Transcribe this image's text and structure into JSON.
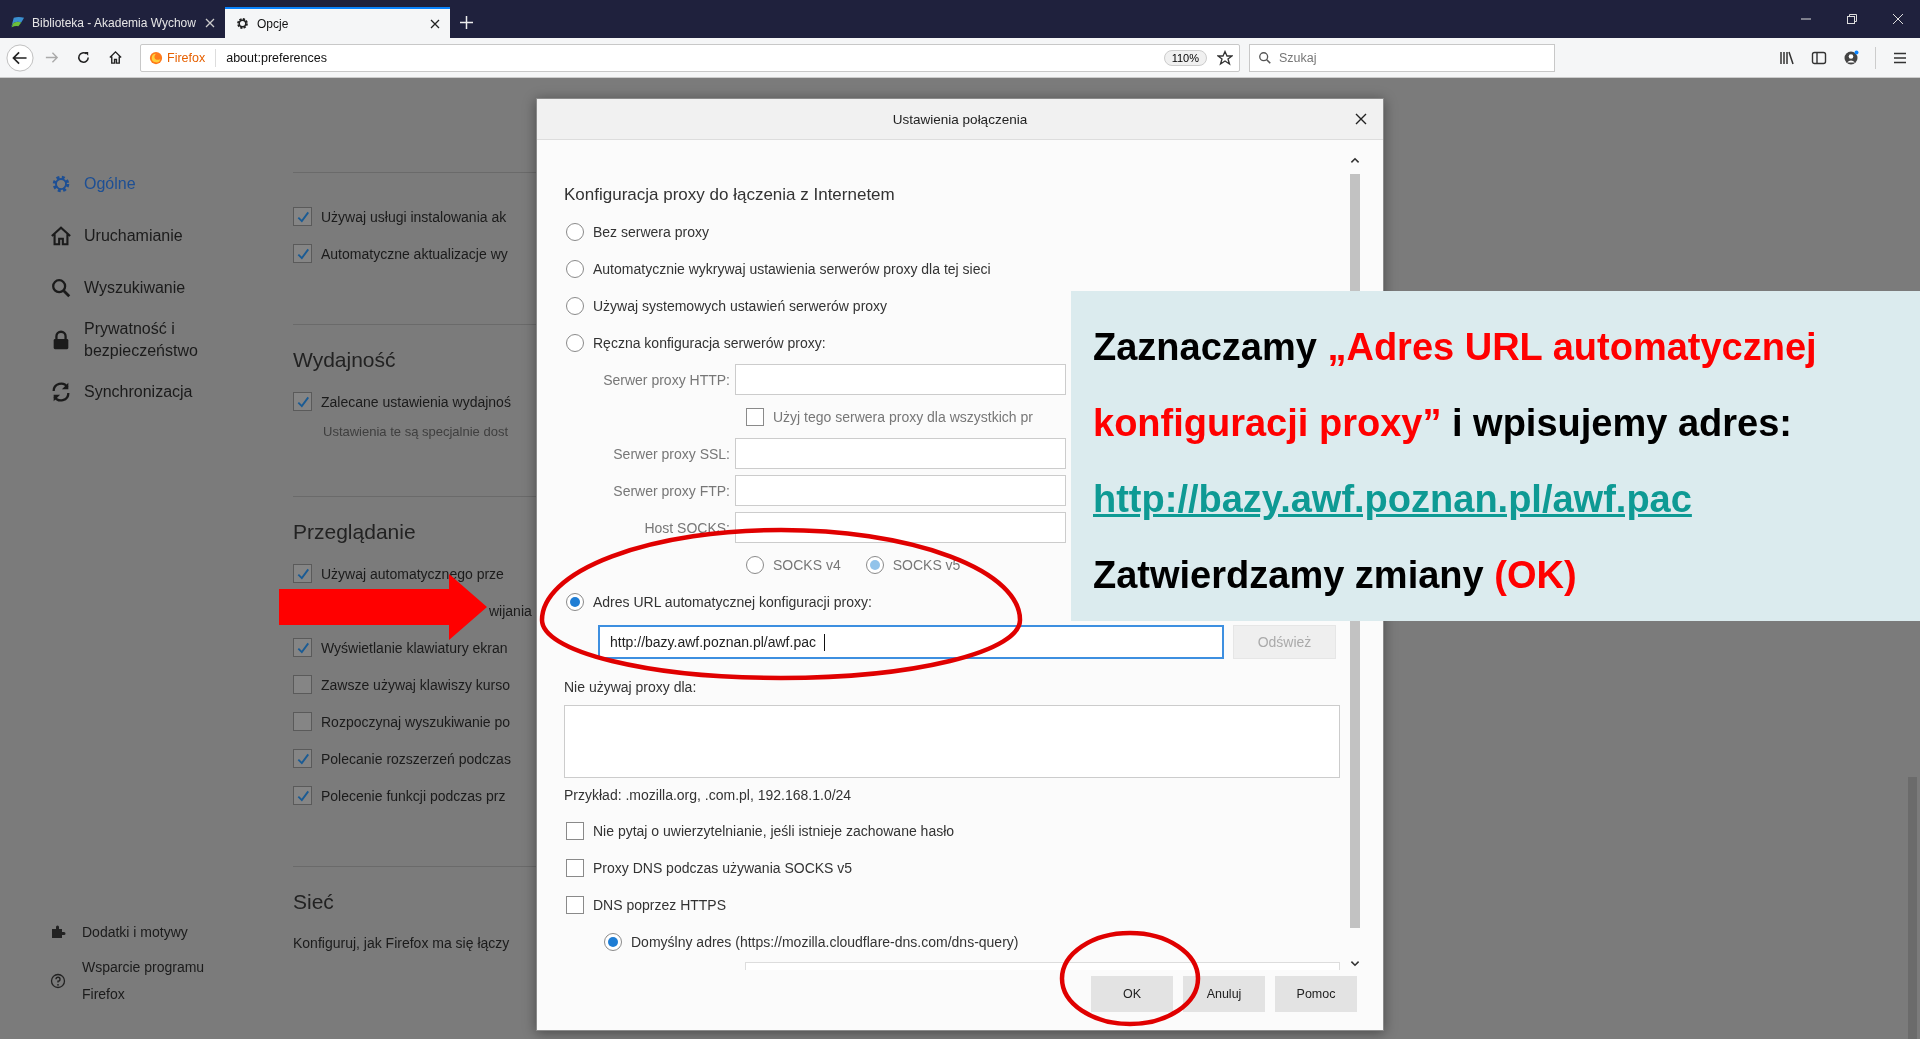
{
  "tabs": [
    {
      "label": "Biblioteka - Akademia Wychow",
      "selected": false
    },
    {
      "label": "Opcje",
      "selected": true
    }
  ],
  "nav": {
    "identity": "Firefox",
    "url": "about:preferences",
    "zoom": "110%",
    "search_placeholder": "Szukaj"
  },
  "sidebar": {
    "items": [
      {
        "label": "Ogólne",
        "selected": true
      },
      {
        "label": "Uruchamianie",
        "selected": false
      },
      {
        "label": "Wyszukiwanie",
        "selected": false
      },
      {
        "label": "Prywatność i bezpieczeństwo",
        "selected": false
      },
      {
        "label": "Synchronizacja",
        "selected": false
      }
    ],
    "footer": [
      {
        "label": "Dodatki i motywy"
      },
      {
        "label": "Wsparcie programu Firefox"
      }
    ]
  },
  "main": {
    "top_checks": [
      {
        "label": "Używaj usługi instalowania ak",
        "checked": true
      },
      {
        "label": "Automatyczne aktualizacje wy",
        "checked": true
      }
    ],
    "sections": [
      {
        "heading": "Wydajność",
        "items": [
          {
            "kind": "check",
            "label": "Zalecane ustawienia wydajnoś",
            "checked": true
          },
          {
            "kind": "note",
            "label": "Ustawienia te są specjalnie dost"
          }
        ]
      },
      {
        "heading": "Przeglądanie",
        "items": [
          {
            "kind": "check",
            "label": "Używaj automatycznego prze",
            "checked": true
          },
          {
            "kind": "fragment",
            "label": "wijania"
          },
          {
            "kind": "check",
            "label": "Wyświetlanie klawiatury ekran",
            "checked": true
          },
          {
            "kind": "check",
            "label": "Zawsze używaj klawiszy kurso",
            "checked": false
          },
          {
            "kind": "check",
            "label": "Rozpoczynaj wyszukiwanie po",
            "checked": false
          },
          {
            "kind": "check",
            "label": "Polecanie rozszerzeń podczas",
            "checked": true
          },
          {
            "kind": "check",
            "label": "Polecenie funkcji podczas prz",
            "checked": true
          }
        ]
      },
      {
        "heading": "Sieć",
        "items": [
          {
            "kind": "text",
            "label": "Konfiguruj, jak Firefox ma się łączy"
          }
        ]
      }
    ]
  },
  "dialog": {
    "title": "Ustawienia połączenia",
    "heading": "Konfiguracja proxy do łączenia z Internetem",
    "proxy_modes": [
      {
        "label": "Bez serwera proxy",
        "selected": false
      },
      {
        "label": "Automatycznie wykrywaj ustawienia serwerów proxy dla tej sieci",
        "selected": false
      },
      {
        "label": "Używaj systemowych ustawień serwerów proxy",
        "selected": false
      },
      {
        "label": "Ręczna konfiguracja serwerów proxy:",
        "selected": false
      },
      {
        "label": "Adres URL automatycznej konfiguracji proxy:",
        "selected": true
      }
    ],
    "manual": {
      "disabled": true,
      "http_label": "Serwer proxy HTTP:",
      "share_all": {
        "label": "Użyj tego serwera proxy dla wszystkich pr",
        "checked": false
      },
      "ssl_label": "Serwer proxy SSL:",
      "ftp_label": "Serwer proxy FTP:",
      "socks_label": "Host SOCKS:",
      "socks_versions": [
        {
          "label": "SOCKS v4",
          "selected": false
        },
        {
          "label": "SOCKS v5",
          "selected": true
        }
      ]
    },
    "auto_url": {
      "value": "http://bazy.awf.poznan.pl/awf.pac",
      "refresh": "Odśwież",
      "refresh_disabled": true
    },
    "no_proxy_label": "Nie używaj proxy dla:",
    "example": "Przykład: .mozilla.org, .com.pl, 192.168.1.0/24",
    "options": [
      {
        "label": "Nie pytaj o uwierzytelnianie, jeśli istnieje zachowane hasło",
        "checked": false
      },
      {
        "label": "Proxy DNS podczas używania SOCKS v5",
        "checked": false
      },
      {
        "label": "DNS poprzez HTTPS",
        "checked": false
      }
    ],
    "doh_default": {
      "label": "Domyślny adres (https://mozilla.cloudflare-dns.com/dns-query)",
      "selected": true
    },
    "buttons": [
      "OK",
      "Anuluj",
      "Pomoc"
    ]
  },
  "callout": {
    "instruction": [
      {
        "text": "Zaznaczamy ",
        "emphasis": false
      },
      {
        "text": "„Adres URL automatycznej konfiguracji proxy”",
        "emphasis": true
      },
      {
        "text": " i wpisujemy adres:",
        "emphasis": false
      }
    ],
    "link": "http://bazy.awf.poznan.pl/awf.pac",
    "confirm": [
      {
        "text": "Zatwierdzamy zmiany ",
        "emphasis": false
      },
      {
        "text": "(OK)",
        "emphasis": true
      }
    ]
  }
}
